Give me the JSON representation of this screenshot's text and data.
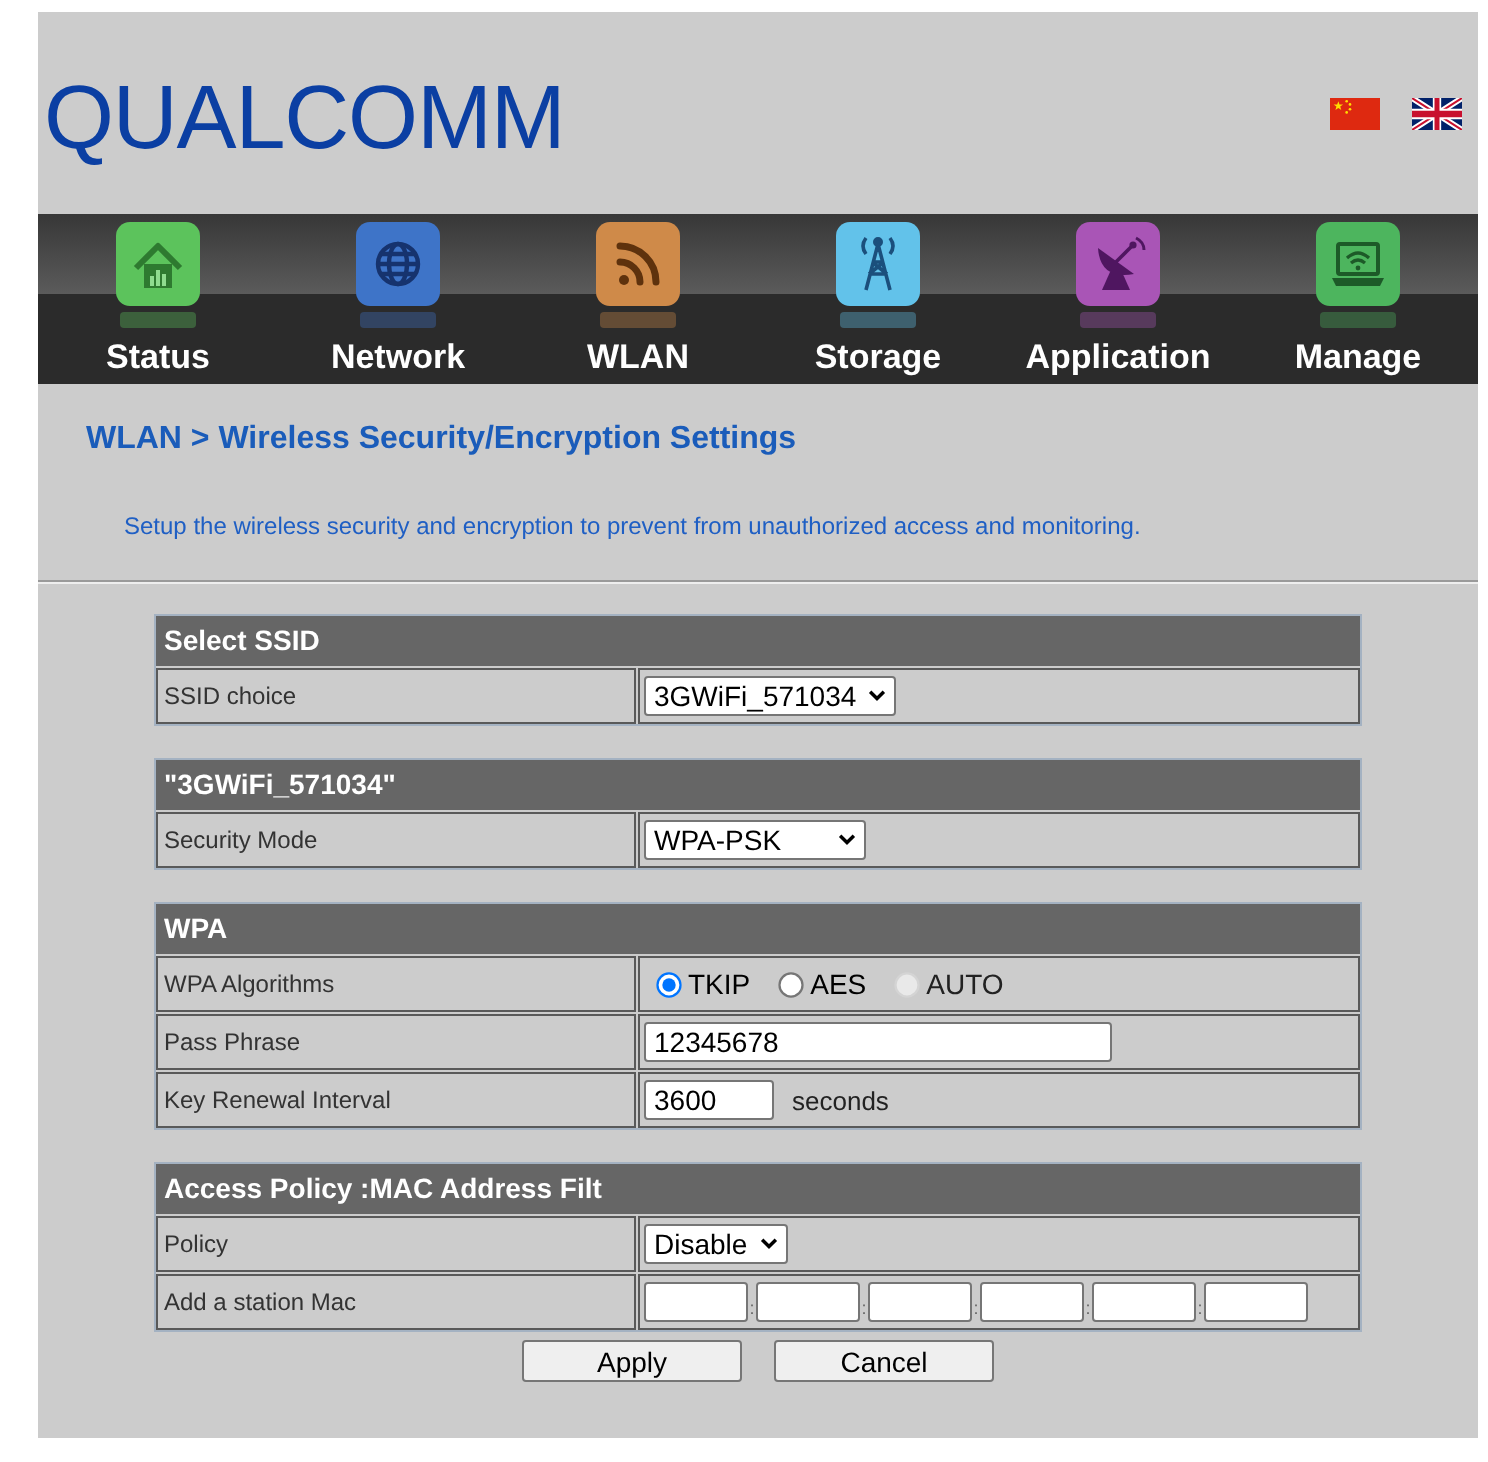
{
  "header": {
    "logo": "QUALCOMM"
  },
  "nav": [
    {
      "label": "Status",
      "color": "#5cc35c"
    },
    {
      "label": "Network",
      "color": "#3e74c8"
    },
    {
      "label": "WLAN",
      "color": "#cf8a49"
    },
    {
      "label": "Storage",
      "color": "#62c2ea"
    },
    {
      "label": "Application",
      "color": "#a955b6"
    },
    {
      "label": "Manage",
      "color": "#4db55e"
    }
  ],
  "page_title": "WLAN > Wireless Security/Encryption Settings",
  "description": "Setup the wireless security and encryption to prevent from unauthorized access and monitoring.",
  "sections": [
    {
      "title": "Select SSID",
      "rows": [
        {
          "label": "SSID choice",
          "kind": "select",
          "value": "3GWiFi_571034"
        }
      ]
    },
    {
      "title": "\"3GWiFi_571034\"",
      "rows": [
        {
          "label": "Security Mode",
          "kind": "select",
          "value": "WPA-PSK"
        }
      ]
    },
    {
      "title": "WPA",
      "rows": [
        {
          "label": "WPA Algorithms",
          "kind": "radios",
          "options": [
            {
              "label": "TKIP",
              "selected": true,
              "disabled": false
            },
            {
              "label": "AES",
              "selected": false,
              "disabled": false
            },
            {
              "label": "AUTO",
              "selected": false,
              "disabled": true
            }
          ]
        },
        {
          "label": "Pass Phrase",
          "kind": "text",
          "value": "12345678"
        },
        {
          "label": "Key Renewal Interval",
          "kind": "text",
          "value": "3600",
          "unit": "seconds"
        }
      ]
    },
    {
      "title": "Access Policy :MAC Address Filt",
      "rows": [
        {
          "label": "Policy",
          "kind": "select",
          "value": "Disable"
        },
        {
          "label": "Add a station Mac",
          "kind": "mac",
          "separators": [
            ":",
            ":",
            ":",
            ":",
            ":"
          ]
        }
      ]
    }
  ],
  "buttons": [
    {
      "label": "Apply"
    },
    {
      "label": "Cancel"
    }
  ]
}
